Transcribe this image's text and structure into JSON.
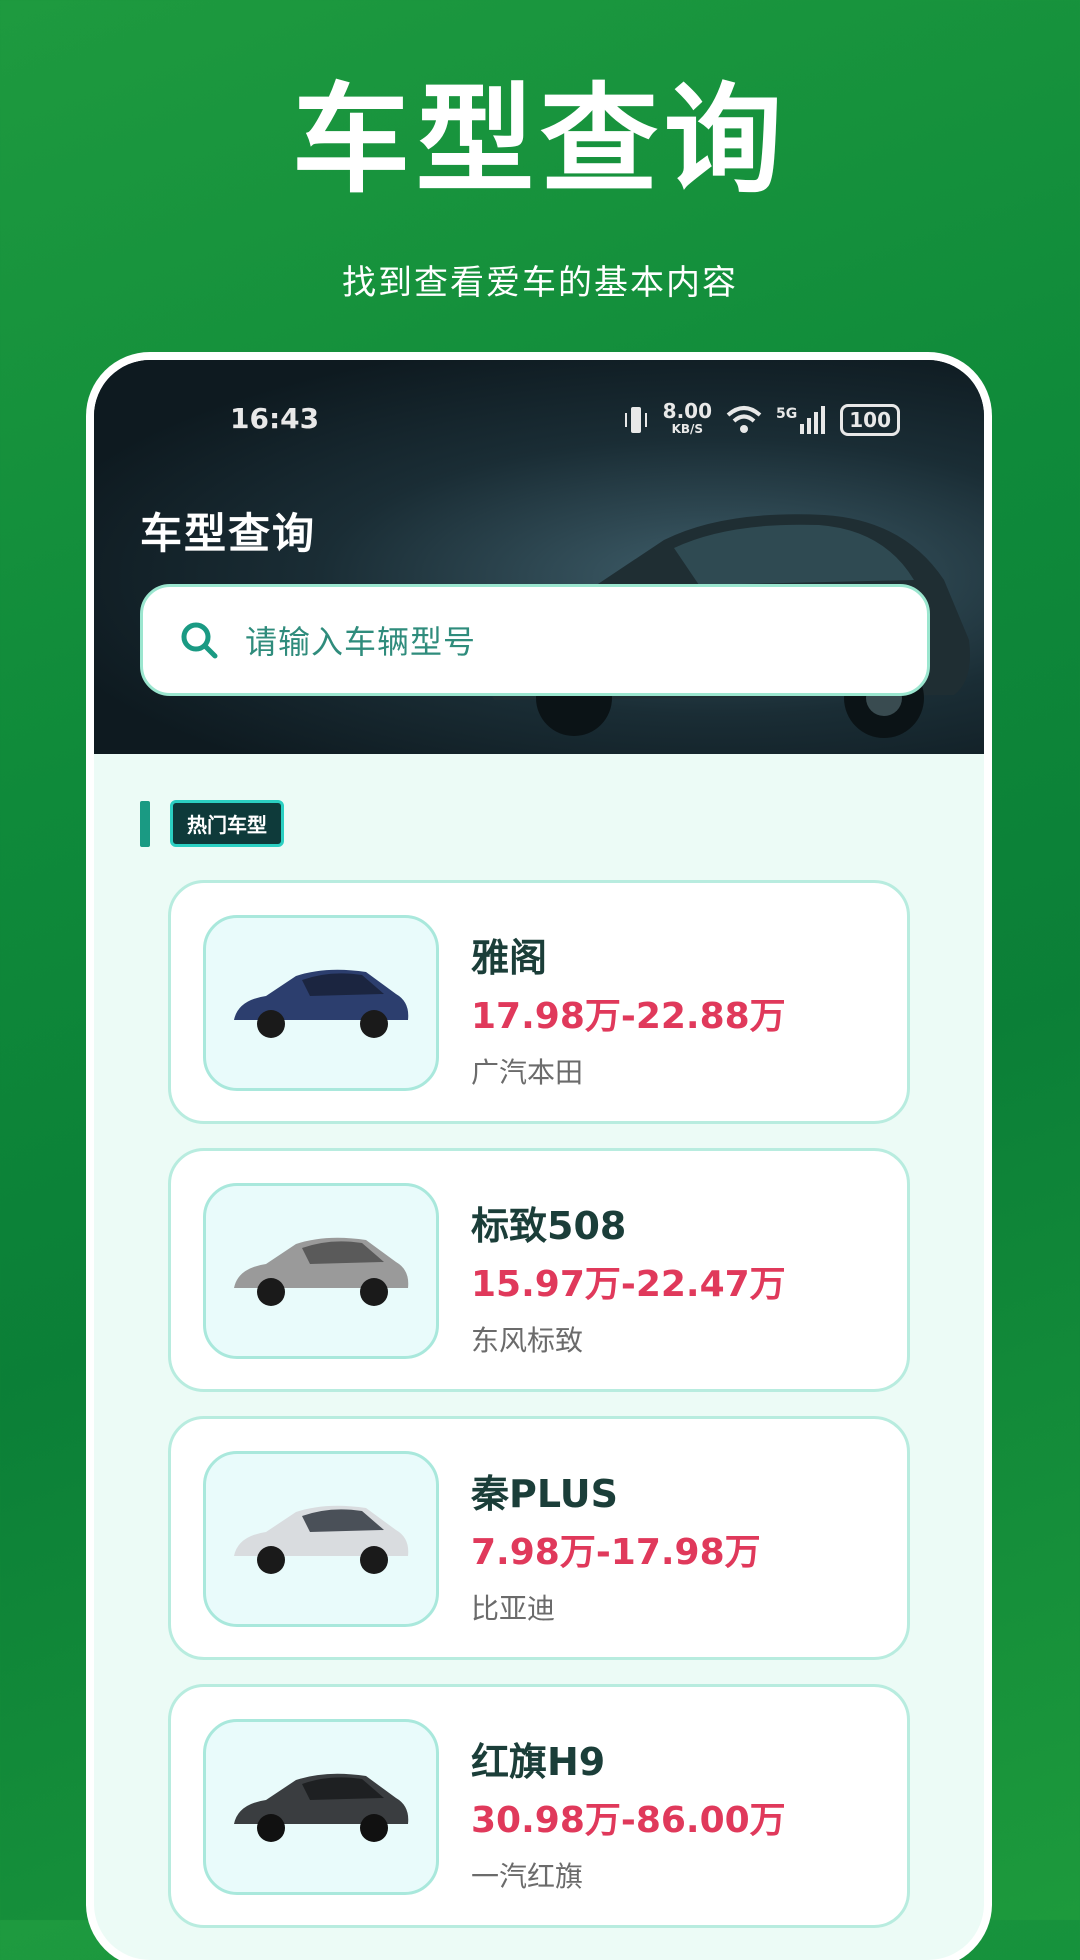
{
  "promo": {
    "title": "车型查询",
    "subtitle": "找到查看爱车的基本内容"
  },
  "status_bar": {
    "time": "16:43",
    "speed": "8.00",
    "speed_unit": "KB/S",
    "network": "5G",
    "battery": "100"
  },
  "header": {
    "title": "车型查询"
  },
  "search": {
    "placeholder": "请输入车辆型号"
  },
  "section": {
    "badge": "热门车型"
  },
  "cars": [
    {
      "name": "雅阁",
      "price": "17.98万-22.88万",
      "maker": "广汽本田",
      "color": "#2c3e6e"
    },
    {
      "name": "标致508",
      "price": "15.97万-22.47万",
      "maker": "东风标致",
      "color": "#9a9a9a"
    },
    {
      "name": "秦PLUS",
      "price": "7.98万-17.98万",
      "maker": "比亚迪",
      "color": "#d9dcdf"
    },
    {
      "name": "红旗H9",
      "price": "30.98万-86.00万",
      "maker": "一汽红旗",
      "color": "#3a3d40"
    }
  ],
  "colors": {
    "accent": "#1a9a83",
    "price": "#e0395b",
    "background": "#0f8a3a"
  }
}
